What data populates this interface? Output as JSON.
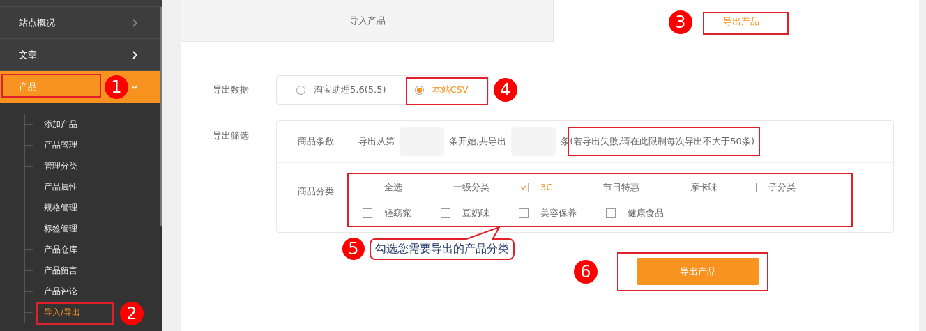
{
  "sidebar": {
    "items": [
      {
        "label": "站点概况",
        "expanded": false,
        "selected": false
      },
      {
        "label": "文章",
        "expanded": false,
        "selected": false
      },
      {
        "label": "产品",
        "expanded": true,
        "selected": true,
        "marker": "1",
        "children": [
          {
            "label": "添加产品",
            "selected": false
          },
          {
            "label": "产品管理",
            "selected": false
          },
          {
            "label": "管理分类",
            "selected": false
          },
          {
            "label": "产品属性",
            "selected": false
          },
          {
            "label": "规格管理",
            "selected": false
          },
          {
            "label": "标签管理",
            "selected": false
          },
          {
            "label": "产品仓库",
            "selected": false
          },
          {
            "label": "产品留言",
            "selected": false
          },
          {
            "label": "产品评论",
            "selected": false
          },
          {
            "label": "导入/导出",
            "selected": true,
            "marker": "2"
          }
        ]
      }
    ]
  },
  "tabs": [
    {
      "label": "导入产品",
      "selected": false
    },
    {
      "label": "导出产品",
      "selected": true,
      "marker": "3"
    }
  ],
  "export_data": {
    "label": "导出数据",
    "options": [
      {
        "label": "淘宝助理5.6(5.5)",
        "selected": false
      },
      {
        "label": "本站CSV",
        "selected": true,
        "marker": "4"
      }
    ]
  },
  "export_filter": {
    "label": "导出筛选",
    "count": {
      "label": "商品条数",
      "text_1": "导出从第",
      "text_2": "条开始,共导出",
      "text_3": "条",
      "note": "(若导出失败,请在此限制每次导出不大于50条)",
      "note_highlighted": true
    },
    "category": {
      "label": "商品分类",
      "marker": "5",
      "callout": "勾选您需要导出的产品分类",
      "options": [
        {
          "label": "全选",
          "checked": false
        },
        {
          "label": "一级分类",
          "checked": false
        },
        {
          "label": "3C",
          "checked": true
        },
        {
          "label": "节日特惠",
          "checked": false
        },
        {
          "label": "摩卡味",
          "checked": false
        },
        {
          "label": "子分类",
          "checked": false
        },
        {
          "label": "轻窈窕",
          "checked": false
        },
        {
          "label": "豆奶味",
          "checked": false
        },
        {
          "label": "美容保养",
          "checked": false
        },
        {
          "label": "健康食品",
          "checked": false
        }
      ]
    }
  },
  "submit": {
    "label": "导出产品",
    "marker": "6"
  }
}
